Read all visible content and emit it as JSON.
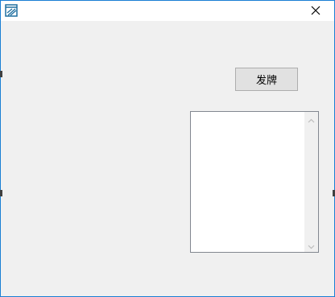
{
  "window": {
    "title": "",
    "app_icon": "form-app-icon",
    "close_icon": "close-icon"
  },
  "deal_button": {
    "label": "发牌"
  },
  "listbox": {
    "items": [],
    "scroll_up_icon": "chevron-up-icon",
    "scroll_down_icon": "chevron-down-icon"
  },
  "colors": {
    "window_border": "#1a7fd4",
    "client_bg": "#f0f0f0",
    "button_bg": "#e1e1e1",
    "button_border": "#adadad",
    "icon_blue": "#1f6f9f"
  }
}
